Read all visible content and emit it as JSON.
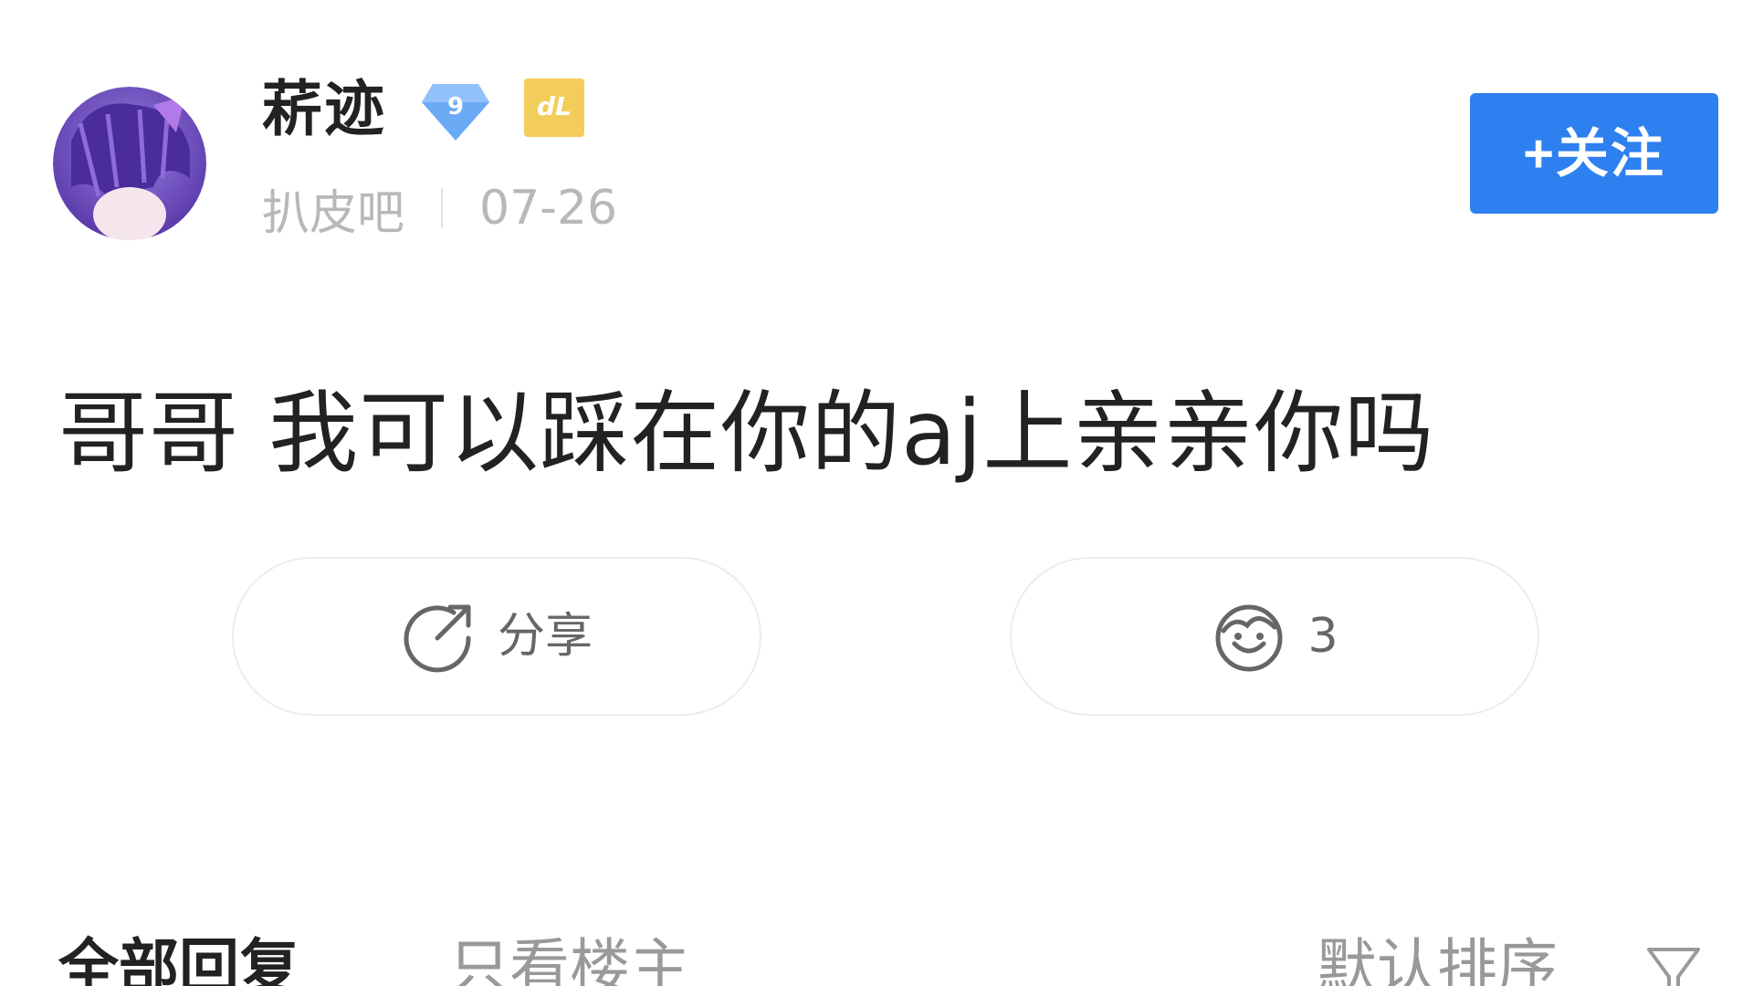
{
  "post": {
    "author": {
      "name": "菥迹",
      "level": "9",
      "member_badge": "dL"
    },
    "forum": "扒皮吧",
    "date": "07-26",
    "follow_label": "+关注",
    "content": "哥哥 我可以踩在你的aj上亲亲你吗"
  },
  "actions": {
    "share_label": "分享",
    "like_count": "3"
  },
  "tabs": {
    "all_replies": "全部回复",
    "owner_only": "只看楼主",
    "sort": "默认排序"
  },
  "colors": {
    "accent": "#2e7ff0",
    "level_badge": "#6aaaf5",
    "member_badge": "#f3cd5c"
  },
  "icons": {
    "share": "share-icon",
    "like": "like-icon",
    "filter": "filter-icon"
  }
}
